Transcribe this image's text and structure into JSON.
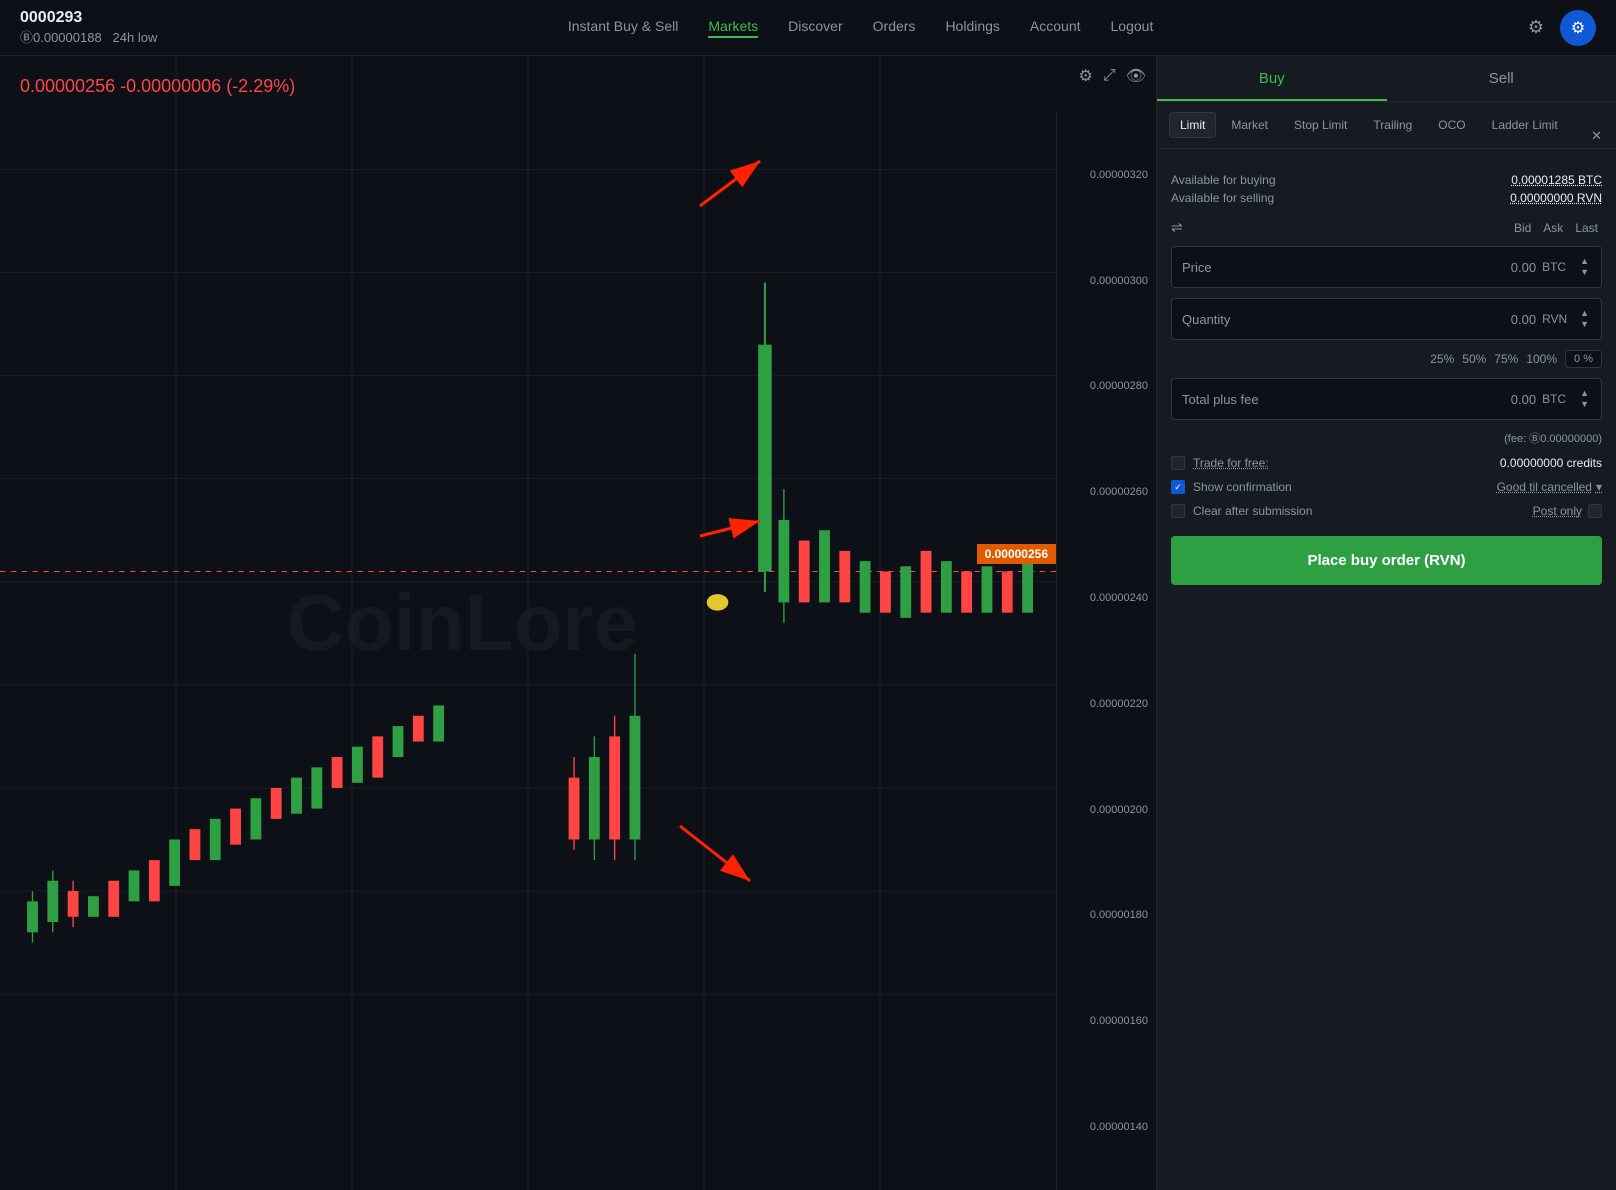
{
  "topnav": {
    "pair": "0000293",
    "price_label": "Ⓑ0.00000188",
    "price_sub": "24h low",
    "links": [
      {
        "label": "Instant Buy & Sell",
        "active": false
      },
      {
        "label": "Markets",
        "active": true
      },
      {
        "label": "Discover",
        "active": false
      },
      {
        "label": "Orders",
        "active": false
      },
      {
        "label": "Holdings",
        "active": false
      },
      {
        "label": "Account",
        "active": false
      },
      {
        "label": "Logout",
        "active": false
      }
    ]
  },
  "chart": {
    "price_change": "0.00000256 -0.00000006 (-2.29%)",
    "current_price": "0.00000256",
    "watermark": "CoinLore",
    "y_labels": [
      "0.00000320",
      "0.00000300",
      "0.00000280",
      "0.00000260",
      "0.00000240",
      "0.00000220",
      "0.00000200",
      "0.00000180",
      "0.00000160",
      "0.00000140"
    ]
  },
  "panel": {
    "buy_label": "Buy",
    "sell_label": "Sell",
    "order_types": [
      {
        "label": "Limit",
        "active": true
      },
      {
        "label": "Market",
        "active": false
      },
      {
        "label": "Stop Limit",
        "active": false
      },
      {
        "label": "Trailing",
        "active": false
      },
      {
        "label": "OCO",
        "active": false
      },
      {
        "label": "Ladder Limit",
        "active": false
      }
    ],
    "available_buying_label": "Available for buying",
    "available_buying_value": "0.00001285 BTC",
    "available_selling_label": "Available for selling",
    "available_selling_value": "0.00000000 RVN",
    "bid_label": "Bid",
    "ask_label": "Ask",
    "last_label": "Last",
    "price_label": "Price",
    "price_value": "0.00",
    "price_currency": "BTC",
    "quantity_label": "Quantity",
    "quantity_value": "0.00",
    "quantity_currency": "RVN",
    "pct_options": [
      "25%",
      "50%",
      "75%",
      "100%"
    ],
    "pct_current": "0 %",
    "total_label": "Total plus fee",
    "total_value": "0.00",
    "total_currency": "BTC",
    "fee_text": "(fee: Ⓑ0.00000000)",
    "trade_free_label": "Trade for free:",
    "credits_value": "0.00000000 credits",
    "show_confirm_label": "Show confirmation",
    "good_til_label": "Good til cancelled",
    "clear_after_label": "Clear after submission",
    "post_only_label": "Post only",
    "place_order_label": "Place buy order (RVN)"
  }
}
